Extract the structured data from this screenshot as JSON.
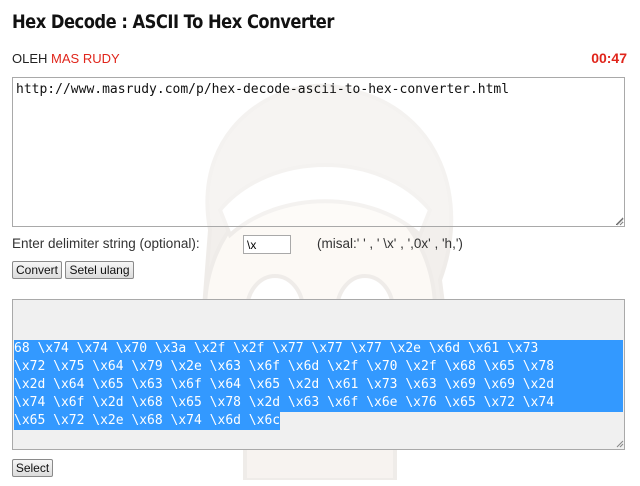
{
  "page": {
    "title": "Hex Decode : ASCII To Hex Converter",
    "byline_prefix": "OLEH",
    "byline_author": "MAS RUDY",
    "timer": "00:47"
  },
  "converter": {
    "input_text": "http://www.masrudy.com/p/hex-decode-ascii-to-hex-converter.html",
    "delimiter_label": "Enter delimiter string (optional):",
    "delimiter_value": "\\x",
    "delimiter_hint": "(misal:' ' , ' \\x' , ',0x' , 'h,')",
    "convert_label": "Convert",
    "reset_label": "Setel ulang",
    "output_lines": [
      "68 \\x74 \\x74 \\x70 \\x3a \\x2f \\x2f \\x77 \\x77 \\x77 \\x2e \\x6d \\x61 \\x73",
      "\\x72 \\x75 \\x64 \\x79 \\x2e \\x63 \\x6f \\x6d \\x2f \\x70 \\x2f \\x68 \\x65 \\x78",
      "\\x2d \\x64 \\x65 \\x63 \\x6f \\x64 \\x65 \\x2d \\x61 \\x73 \\x63 \\x69 \\x69 \\x2d",
      "\\x74 \\x6f \\x2d \\x68 \\x65 \\x78 \\x2d \\x63 \\x6f \\x6e \\x76 \\x65 \\x72 \\x74",
      "\\x65 \\x72 \\x2e \\x68 \\x74 \\x6d \\x6c"
    ],
    "select_label": "Select",
    "highlight_color": "#3399ff",
    "accent_color": "#e0251b"
  },
  "icons": {
    "watermark": "mascot-watermark-icon",
    "resize": "resize-grip-icon"
  }
}
